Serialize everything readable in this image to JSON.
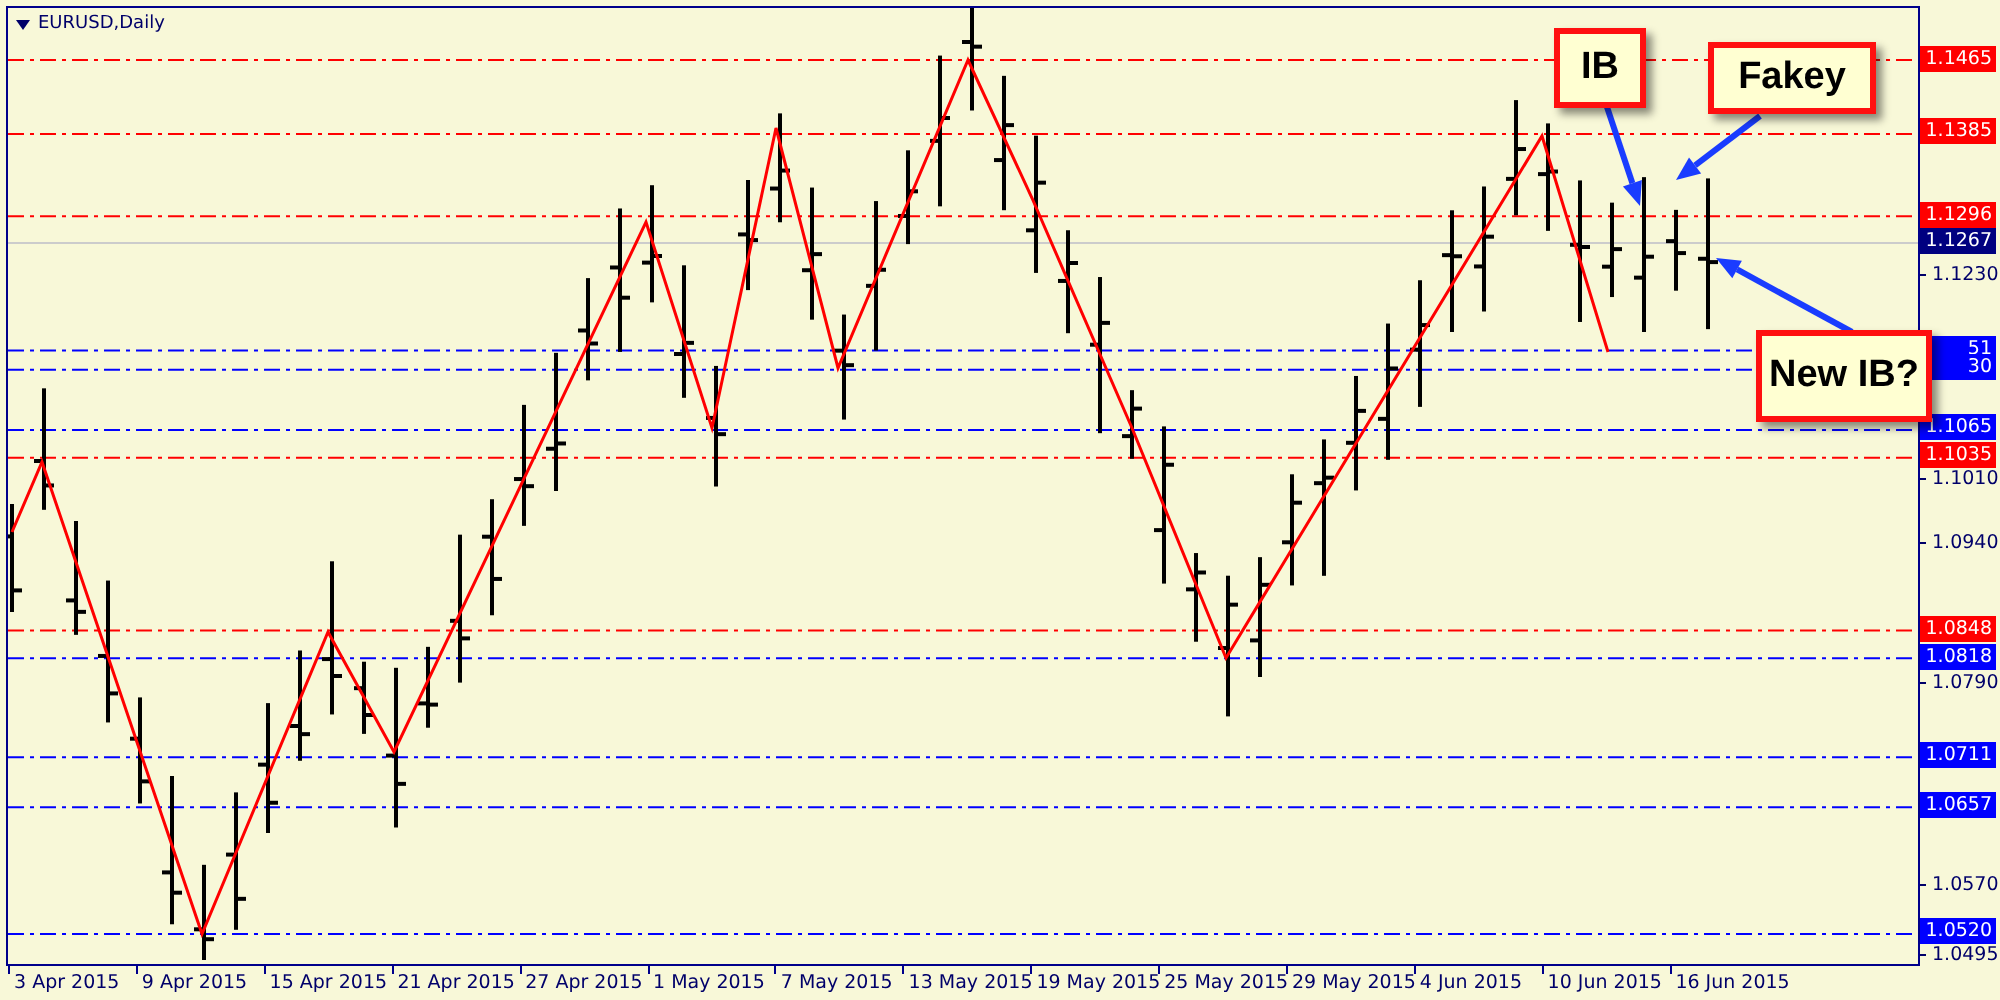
{
  "chart": {
    "title": "EURUSD,Daily",
    "levels": [
      {
        "kind": "level",
        "label": "1.1465",
        "color": "#ff0000"
      },
      {
        "kind": "level",
        "label": "1.1385",
        "color": "#ff0000"
      },
      {
        "kind": "level",
        "label": "1.1296",
        "color": "#ff0000"
      },
      {
        "kind": "current",
        "label": "1.1267",
        "color": "#000080"
      },
      {
        "kind": "clipped",
        "label": "51",
        "color": "#0000ff"
      },
      {
        "kind": "clipped",
        "label": "30",
        "color": "#0000ff"
      },
      {
        "kind": "level",
        "label": "1.1065",
        "color": "#0000ff"
      },
      {
        "kind": "level",
        "label": "1.1035",
        "color": "#ff0000"
      },
      {
        "kind": "level",
        "label": "1.0848",
        "color": "#ff0000"
      },
      {
        "kind": "level",
        "label": "1.0818",
        "color": "#0000ff"
      },
      {
        "kind": "level",
        "label": "1.0711",
        "color": "#0000ff"
      },
      {
        "kind": "level",
        "label": "1.0657",
        "color": "#0000ff"
      },
      {
        "kind": "level",
        "label": "1.0520",
        "color": "#0000ff"
      }
    ],
    "price_ticks": [
      "1.1230",
      "1.1010",
      "1.0940",
      "1.0790",
      "1.0570",
      "1.0495"
    ],
    "date_ticks": [
      "3 Apr 2015",
      "9 Apr 2015",
      "15 Apr 2015",
      "21 Apr 2015",
      "27 Apr 2015",
      "1 May 2015",
      "7 May 2015",
      "13 May 2015",
      "19 May 2015",
      "25 May 2015",
      "29 May 2015",
      "4 Jun 2015",
      "10 Jun 2015",
      "16 Jun 2015"
    ]
  },
  "callouts": [
    {
      "text": "IB"
    },
    {
      "text": "Fakey"
    },
    {
      "text": "New IB?"
    }
  ]
}
